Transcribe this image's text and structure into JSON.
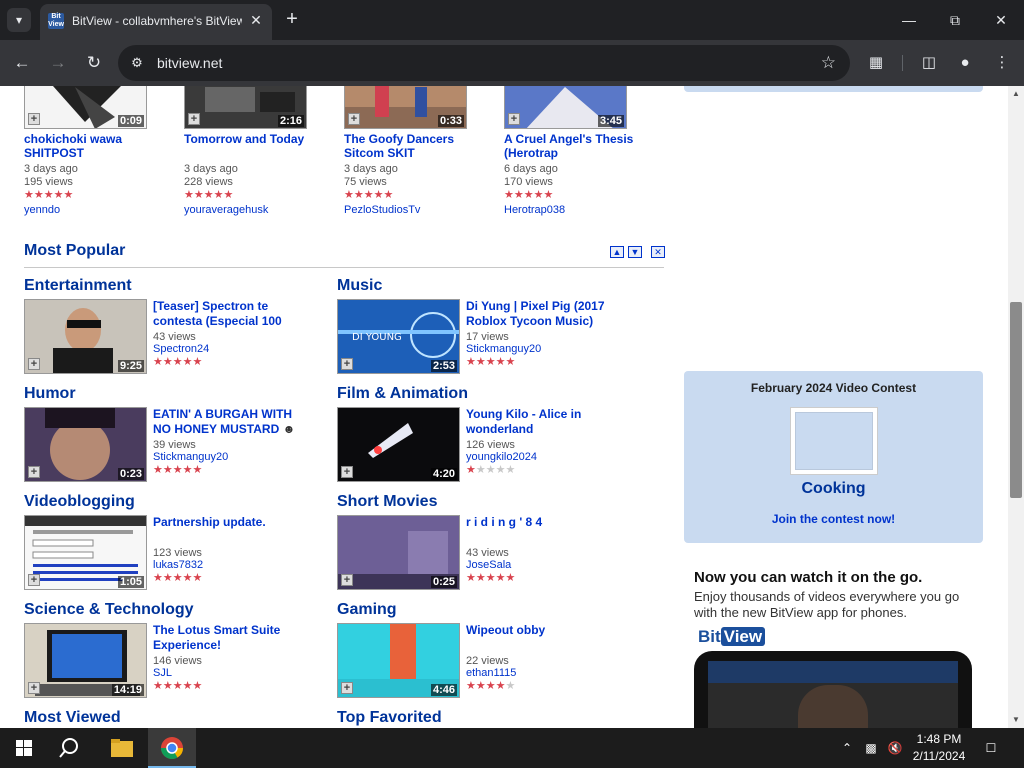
{
  "browser": {
    "tab_title": "BitView - collabvmhere's BitView",
    "favicon_text": "Bit View",
    "url": "bitview.net",
    "icons": [
      "tab-search-icon",
      "close-icon",
      "plus-icon",
      "minimize-icon",
      "restore-icon",
      "back-icon",
      "forward-icon",
      "reload-icon",
      "site-info-icon",
      "bookmark-star-icon",
      "extensions-icon",
      "side-panel-icon",
      "profile-icon",
      "menu-icon"
    ]
  },
  "recent_videos": [
    {
      "title": "chokichoki wawa SHITPOST",
      "duration": "0:09",
      "age": "3 days ago",
      "views": "195 views",
      "rating": 4.5,
      "user": "yenndo"
    },
    {
      "title": "Tomorrow and Today",
      "duration": "2:16",
      "age": "3 days ago",
      "views": "228 views",
      "rating": 4.5,
      "user": "youraveragehusk"
    },
    {
      "title": "The Goofy Dancers Sitcom SKIT",
      "duration": "0:33",
      "age": "3 days ago",
      "views": "75 views",
      "rating": 4.5,
      "user": "PezloStudiosTv"
    },
    {
      "title": "A Cruel Angel's Thesis (Herotrap",
      "duration": "3:45",
      "age": "6 days ago",
      "views": "170 views",
      "rating": 5,
      "user": "Herotrap038"
    }
  ],
  "most_popular": {
    "heading": "Most Popular",
    "controls": [
      "move-up-icon",
      "move-down-icon",
      "close-section-icon"
    ],
    "categories": [
      {
        "name": "Entertainment",
        "title": "[Teaser] Spectron te contesta (Especial 100",
        "duration": "9:25",
        "views": "43 views",
        "user": "Spectron24",
        "rating": 5
      },
      {
        "name": "Music",
        "title": "Di Yung | Pixel Pig (2017 Roblox Tycoon Music)",
        "duration": "2:53",
        "views": "17 views",
        "user": "Stickmanguy20",
        "rating": 5
      },
      {
        "name": "Humor",
        "title": "EATIN' A BURGAH WITH NO HONEY MUSTARD",
        "duration": "0:23",
        "views": "39 views",
        "user": "Stickmanguy20",
        "rating": 5
      },
      {
        "name": "Film & Animation",
        "title": "Young Kilo - Alice in wonderland",
        "duration": "4:20",
        "views": "126 views",
        "user": "youngkilo2024",
        "rating": 1
      },
      {
        "name": "Videoblogging",
        "title": "Partnership update.",
        "duration": "1:05",
        "views": "123 views",
        "user": "lukas7832",
        "rating": 4.5
      },
      {
        "name": "Short Movies",
        "title": "r i d i n g ' 8 4",
        "duration": "0:25",
        "views": "43 views",
        "user": "JoseSala",
        "rating": 5
      },
      {
        "name": "Science & Technology",
        "title": "The Lotus Smart Suite Experience!",
        "duration": "14:19",
        "views": "146 views",
        "user": "SJL",
        "rating": 5
      },
      {
        "name": "Gaming",
        "title": "Wipeout obby",
        "duration": "4:46",
        "views": "22 views",
        "user": "ethan1115",
        "rating": 3.5
      }
    ],
    "next_sections": [
      "Most Viewed",
      "Top Favorited"
    ]
  },
  "contest": {
    "title": "February 2024 Video Contest",
    "name": "Cooking",
    "cta": "Join the contest now!"
  },
  "ad": {
    "headline": "Now you can watch it on the go.",
    "text": "Enjoy thousands of videos everywhere you go with the new BitView app for phones.",
    "logo_bit": "Bit",
    "logo_view": "View"
  },
  "taskbar": {
    "time": "1:48 PM",
    "date": "2/11/2024",
    "apps": [
      "start-icon",
      "search-icon",
      "file-explorer-icon",
      "chrome-icon"
    ],
    "tray": [
      "show-hidden-icons-icon",
      "network-icon",
      "volume-muted-icon",
      "notifications-icon"
    ]
  },
  "colors": {
    "link": "#0033cc",
    "heading": "#003399",
    "star_on": "#d9434e",
    "sidebox": "#c9daf0"
  }
}
